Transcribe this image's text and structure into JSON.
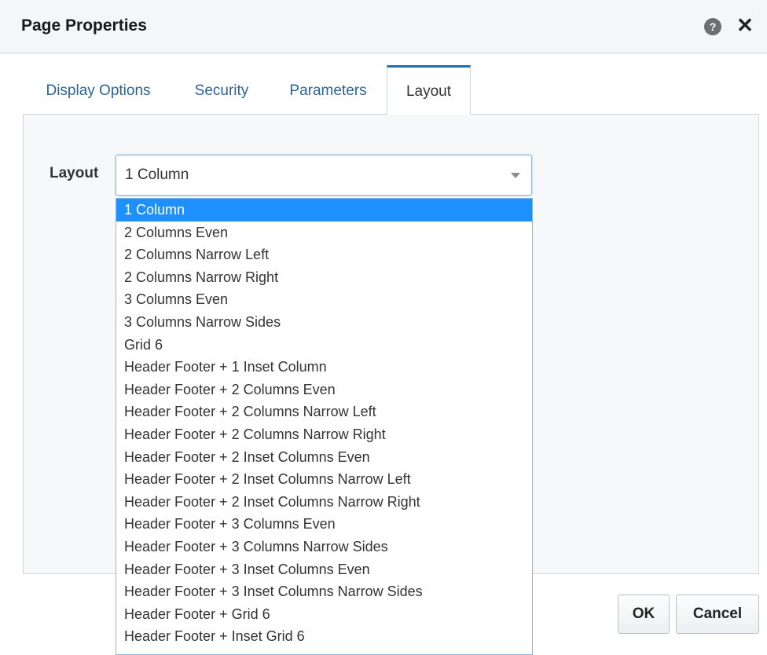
{
  "dialog": {
    "title": "Page Properties",
    "help_icon_text": "?",
    "close_icon_text": "✕"
  },
  "tabs": [
    {
      "label": "Display Options",
      "active": false
    },
    {
      "label": "Security",
      "active": false
    },
    {
      "label": "Parameters",
      "active": false
    },
    {
      "label": "Layout",
      "active": true
    }
  ],
  "layout_field": {
    "label": "Layout",
    "selected_value": "1 Column",
    "options": [
      "1 Column",
      "2 Columns Even",
      "2 Columns Narrow Left",
      "2 Columns Narrow Right",
      "3 Columns Even",
      "3 Columns Narrow Sides",
      "Grid 6",
      "Header Footer + 1 Inset Column",
      "Header Footer + 2 Columns Even",
      "Header Footer + 2 Columns Narrow Left",
      "Header Footer + 2 Columns Narrow Right",
      "Header Footer + 2 Inset Columns Even",
      "Header Footer + 2 Inset Columns Narrow Left",
      "Header Footer + 2 Inset Columns Narrow Right",
      "Header Footer + 3 Columns Even",
      "Header Footer + 3 Columns Narrow Sides",
      "Header Footer + 3 Inset Columns Even",
      "Header Footer + 3 Inset Columns Narrow Sides",
      "Header Footer + Grid 6",
      "Header Footer + Inset Grid 6"
    ]
  },
  "buttons": {
    "ok_label": "OK",
    "cancel_label": "Cancel"
  },
  "colors": {
    "accent": "#1f6fb5",
    "selection": "#1e90ff",
    "tab_link": "#2a6496"
  }
}
